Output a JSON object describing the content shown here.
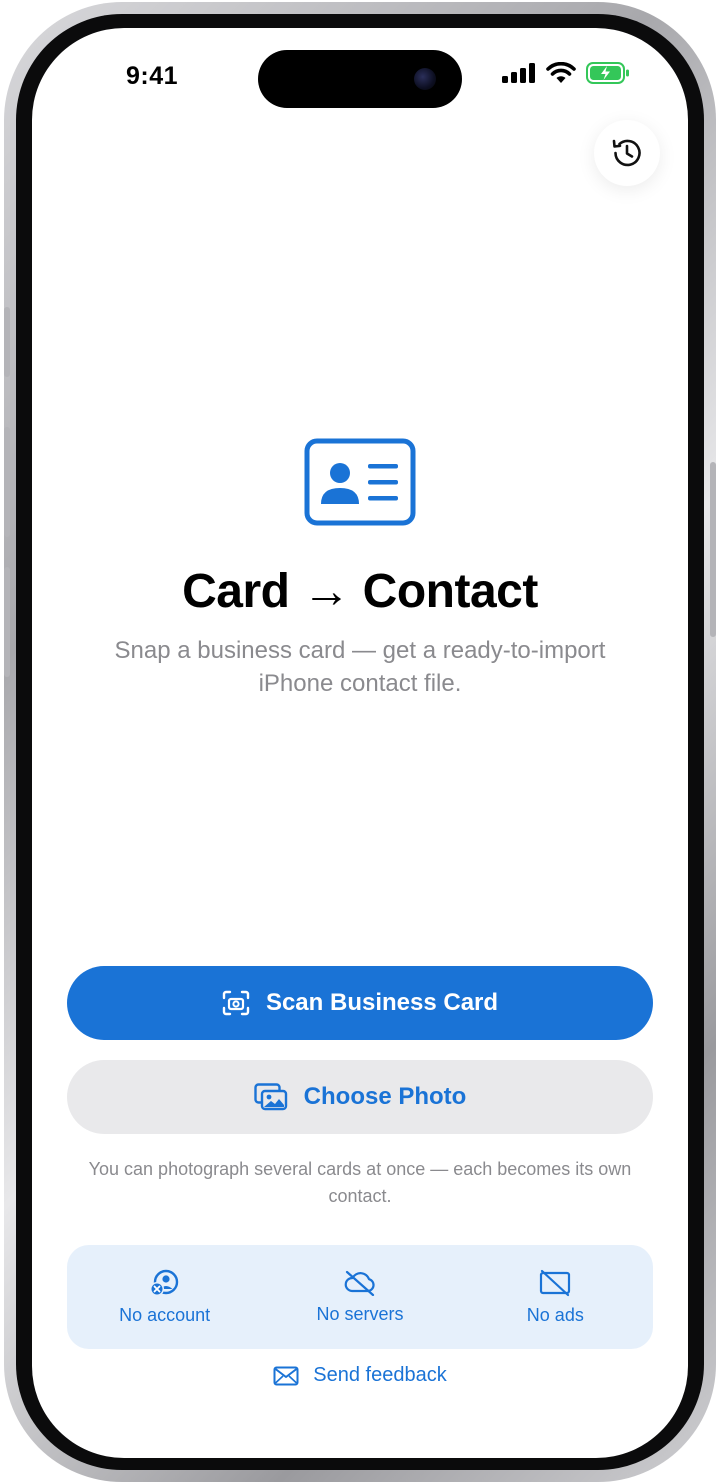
{
  "status_bar": {
    "time": "9:41"
  },
  "hero": {
    "title": "Card → Contact",
    "subtitle": "Snap a business card — get a ready-to-import iPhone contact file."
  },
  "actions": {
    "scan_label": "Scan Business Card",
    "choose_label": "Choose Photo"
  },
  "hint": "You can photograph several cards at once — each becomes its own contact.",
  "features": [
    {
      "label": "No account",
      "icon": "person-x-icon"
    },
    {
      "label": "No servers",
      "icon": "cloud-slash-icon"
    },
    {
      "label": "No ads",
      "icon": "rectangle-slash-icon"
    }
  ],
  "feedback_label": "Send feedback",
  "colors": {
    "accent": "#1a73d6",
    "accent_soft": "#e6f0fb",
    "secondary_bg": "#e9e9eb",
    "subtle_text": "#8a8a8e",
    "battery": "#34c759"
  }
}
